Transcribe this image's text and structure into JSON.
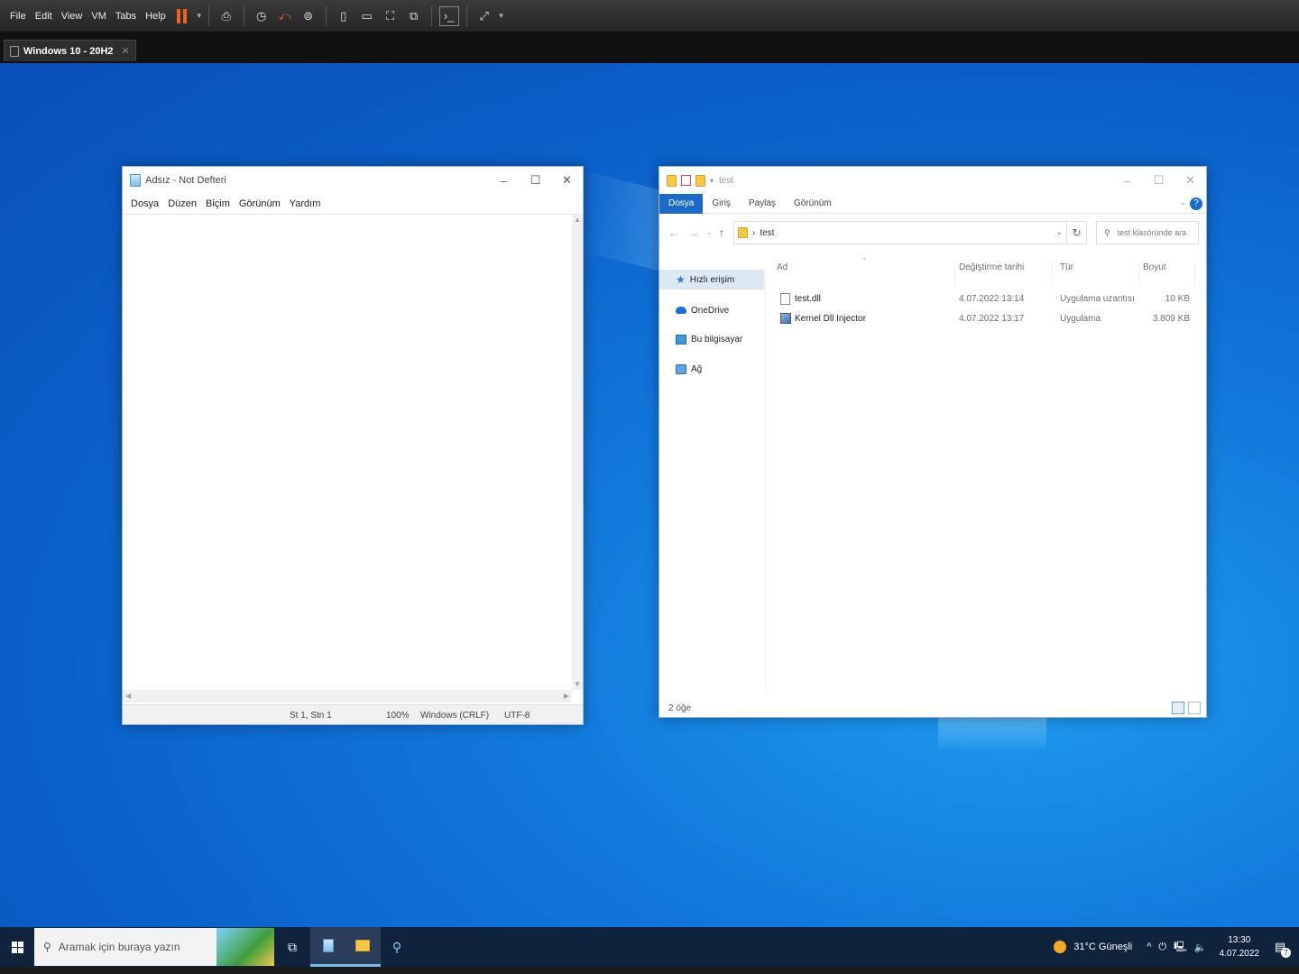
{
  "vm": {
    "menus": [
      "File",
      "Edit",
      "View",
      "VM",
      "Tabs",
      "Help"
    ],
    "tab_title": "Windows 10 - 20H2",
    "tab_close": "✕"
  },
  "notepad": {
    "title": "Adsız - Not Defteri",
    "menus": [
      "Dosya",
      "Düzen",
      "Biçim",
      "Görünüm",
      "Yardım"
    ],
    "status": {
      "position": "St 1, Stn 1",
      "zoom": "100%",
      "line_ending": "Windows (CRLF)",
      "encoding": "UTF-8"
    }
  },
  "explorer": {
    "title": "test",
    "ribbon_tabs": [
      "Dosya",
      "Giriş",
      "Paylaş",
      "Görünüm"
    ],
    "help": "?",
    "address": {
      "separator": "›",
      "path": "test"
    },
    "search_placeholder": "test klasöründe ara",
    "nav": [
      "Hızlı erişim",
      "OneDrive",
      "Bu bilgisayar",
      "Ağ"
    ],
    "columns": [
      "Ad",
      "Değiştirme tarihi",
      "Tür",
      "Boyut"
    ],
    "files": [
      {
        "name": "test.dll",
        "date": "4.07.2022 13:14",
        "type": "Uygulama uzantısı",
        "size": "10 KB",
        "icon": "dll-file-icon"
      },
      {
        "name": "Kernel Dll Injector",
        "date": "4.07.2022 13:17",
        "type": "Uygulama",
        "size": "3.809 KB",
        "icon": "application-icon"
      }
    ],
    "status": "2 öğe"
  },
  "taskbar": {
    "search_placeholder": "Aramak için buraya yazın",
    "weather": "31°C  Güneşli",
    "time": "13:30",
    "date": "4.07.2022",
    "notification_count": "7"
  },
  "colors": {
    "accent": "#1a6bc9",
    "taskbar": "#10233d",
    "pause": "#e8641e"
  }
}
